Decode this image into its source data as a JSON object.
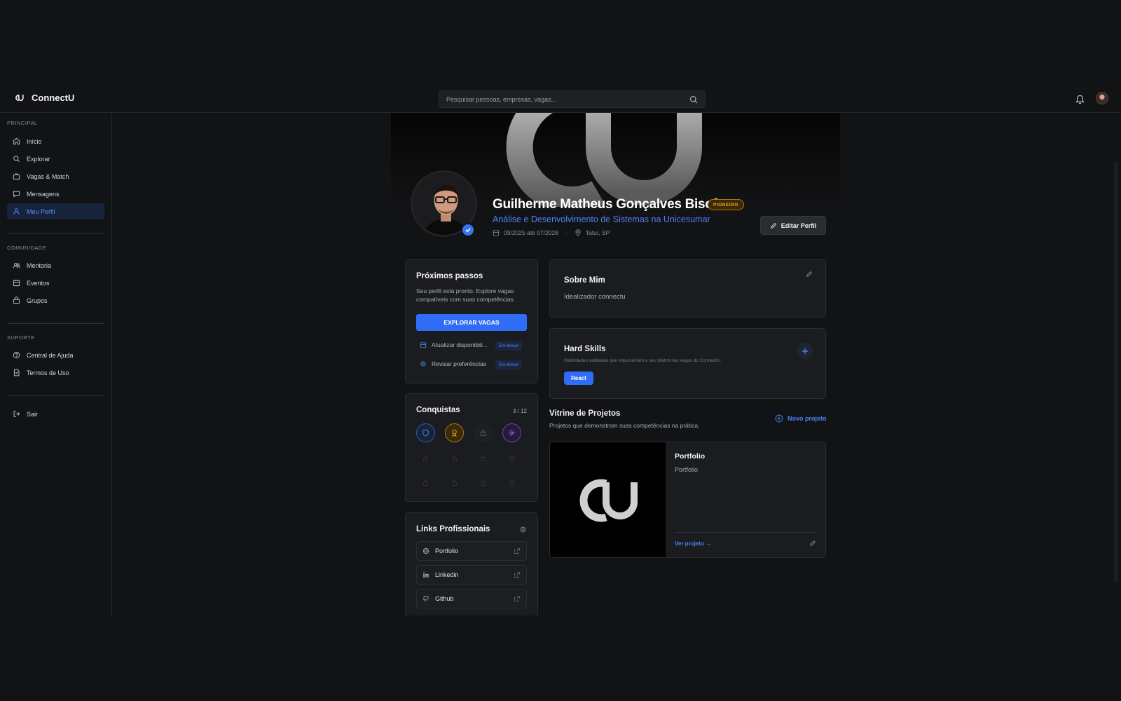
{
  "app": {
    "name": "ConnectU"
  },
  "search": {
    "placeholder": "Pesquisar pessoas, empresas, vagas..."
  },
  "sidebar": {
    "sections": [
      {
        "label": "PRINCIPAL",
        "items": [
          {
            "label": "Início",
            "icon": "home-icon"
          },
          {
            "label": "Explorar",
            "icon": "search-icon"
          },
          {
            "label": "Vagas & Match",
            "icon": "briefcase-icon"
          },
          {
            "label": "Mensagens",
            "icon": "message-icon"
          },
          {
            "label": "Meu Perfil",
            "icon": "user-icon",
            "active": true
          }
        ]
      },
      {
        "label": "COMUNIDADE",
        "items": [
          {
            "label": "Mentoria",
            "icon": "users-icon"
          },
          {
            "label": "Eventos",
            "icon": "calendar-icon"
          },
          {
            "label": "Grupos",
            "icon": "group-icon"
          }
        ]
      },
      {
        "label": "SUPORTE",
        "items": [
          {
            "label": "Central de Ajuda",
            "icon": "help-icon"
          },
          {
            "label": "Termos de Uso",
            "icon": "document-icon"
          }
        ]
      }
    ],
    "logout": {
      "label": "Sair",
      "icon": "logout-icon"
    }
  },
  "profile": {
    "name": "Guilherme Matheus Gonçalves Bisof",
    "badge": "PIONEIRO",
    "course": "Análise e Desenvolvimento de Sistemas na Unicesumar",
    "period": "09/2025 até 07/2028",
    "separator": "·",
    "location": "Tatuí, SP",
    "edit_label": "Editar Perfil"
  },
  "next_steps": {
    "title": "Próximos passos",
    "text": "Seu perfil está pronto. Explore vagas compatíveis com suas competências.",
    "cta": "EXPLORAR VAGAS",
    "tasks": [
      {
        "label": "Atualizar disponibili...",
        "status": "Em breve"
      },
      {
        "label": "Revisar preferências",
        "status": "Em breve"
      }
    ]
  },
  "achievements": {
    "title": "Conquistas",
    "count": "3 / 12"
  },
  "links": {
    "title": "Links Profissionais",
    "items": [
      {
        "label": "Portfolio",
        "icon": "globe-icon"
      },
      {
        "label": "Linkedin",
        "icon": "linkedin-icon"
      },
      {
        "label": "Github",
        "icon": "github-icon"
      }
    ]
  },
  "about": {
    "title": "Sobre Mim",
    "text": "Idealizador connectu"
  },
  "skills": {
    "title": "Hard Skills",
    "subtitle": "Habilidades validadas que impulsionam o seu Match nas vagas do ConnectU.",
    "items": [
      "React"
    ]
  },
  "projects": {
    "title": "Vitrine de Projetos",
    "subtitle": "Projetos que demonstram suas competências na prática.",
    "new_label": "Novo projeto",
    "items": [
      {
        "title": "Portfolio",
        "description": "Portfolio",
        "link_label": "Ver projeto →"
      }
    ]
  },
  "colors": {
    "accent": "#2f6df6",
    "badge": "#f0a91e",
    "background": "#121315",
    "card": "#1b1c1f"
  }
}
